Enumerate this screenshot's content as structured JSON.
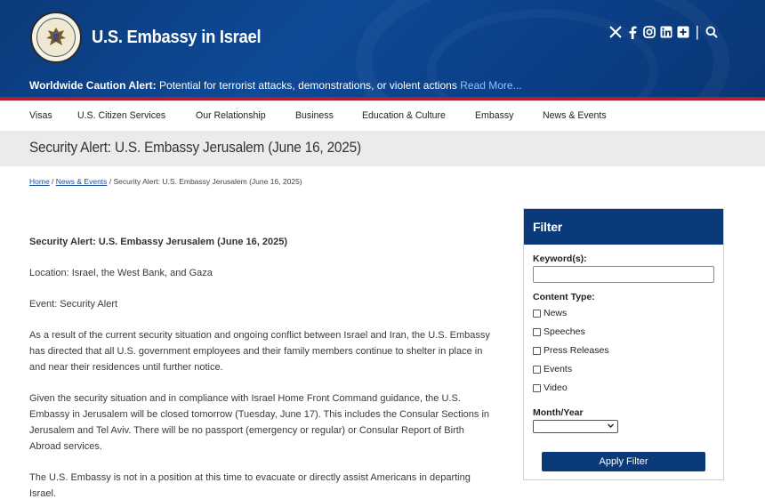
{
  "header": {
    "site_title": "U.S. Embassy in Israel",
    "social_icons": [
      "x-icon",
      "facebook-icon",
      "instagram-icon",
      "linkedin-icon",
      "flickr-icon"
    ],
    "alert_label": "Worldwide Caution Alert:",
    "alert_text": "Potential for terrorist attacks, demonstrations, or violent actions",
    "alert_link": "Read More..."
  },
  "nav": {
    "items": [
      "Visas",
      "U.S. Citizen Services",
      "Our Relationship",
      "Business",
      "Education & Culture",
      "Embassy",
      "News & Events"
    ]
  },
  "page": {
    "title": "Security Alert: U.S. Embassy Jerusalem (June 16, 2025)"
  },
  "breadcrumb": {
    "home": "Home",
    "sep1": " / ",
    "news": "News & Events",
    "sep2": " / ",
    "current": "Security Alert: U.S. Embassy Jerusalem (June 16, 2025)"
  },
  "content": {
    "heading": "Security Alert:  U.S. Embassy Jerusalem (June 16, 2025)",
    "location": "Location: Israel, the West Bank, and Gaza",
    "event": "Event: Security Alert",
    "para1": "As a result of the current security situation and ongoing conflict between Israel and Iran, the U.S. Embassy has directed that all U.S. government employees and their family members continue to shelter in place in and near their residences until further notice.",
    "para2": "Given the security situation and in compliance with Israel Home Front Command guidance, the U.S. Embassy in Jerusalem will be closed tomorrow (Tuesday, June 17). This includes the Consular Sections in Jerusalem and Tel Aviv. There will be no passport (emergency or regular) or Consular Report of Birth Abroad services.",
    "para3": "The U.S. Embassy is not in a position at this time to evacuate or directly assist Americans in departing Israel."
  },
  "filter": {
    "title": "Filter",
    "keyword_label": "Keyword(s):",
    "keyword_value": "",
    "content_type_label": "Content Type:",
    "content_types": [
      "News",
      "Speeches",
      "Press Releases",
      "Events",
      "Video"
    ],
    "month_year_label": "Month/Year",
    "month_year_value": "",
    "apply_label": "Apply Filter"
  },
  "colors": {
    "header_blue": "#0b3a7a",
    "alert_red": "#b3202c",
    "link_blue": "#1a4f9a"
  }
}
